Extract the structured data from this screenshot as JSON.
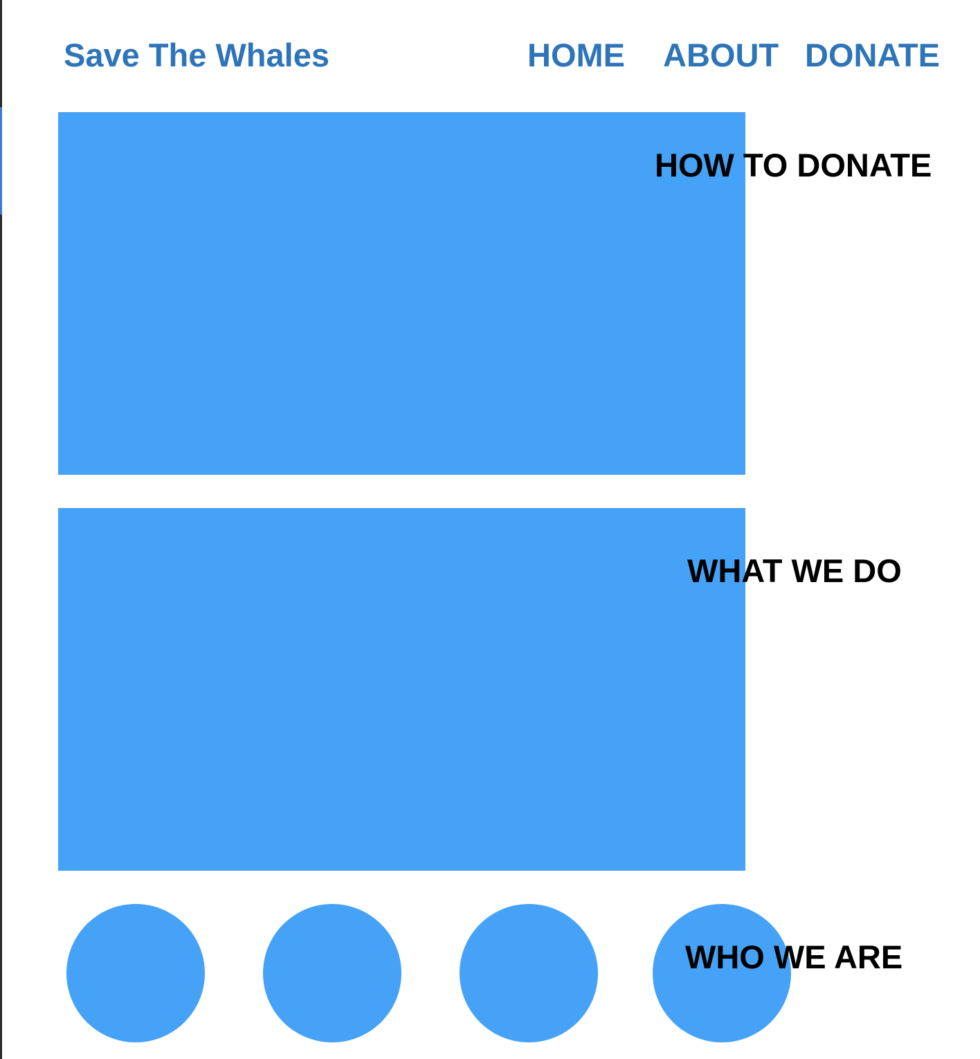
{
  "colors": {
    "brand_blue": "#2e74b8",
    "panel_blue": "#45a2f7",
    "heading_black": "#000000",
    "background": "#ffffff"
  },
  "header": {
    "brand": "Save The Whales",
    "nav": {
      "home": "HOME",
      "about": "ABOUT",
      "donate": "DONATE"
    }
  },
  "sections": {
    "how_to_donate": "HOW TO DONATE",
    "what_we_do": "WHAT WE DO",
    "who_we_are": "WHO WE ARE"
  }
}
